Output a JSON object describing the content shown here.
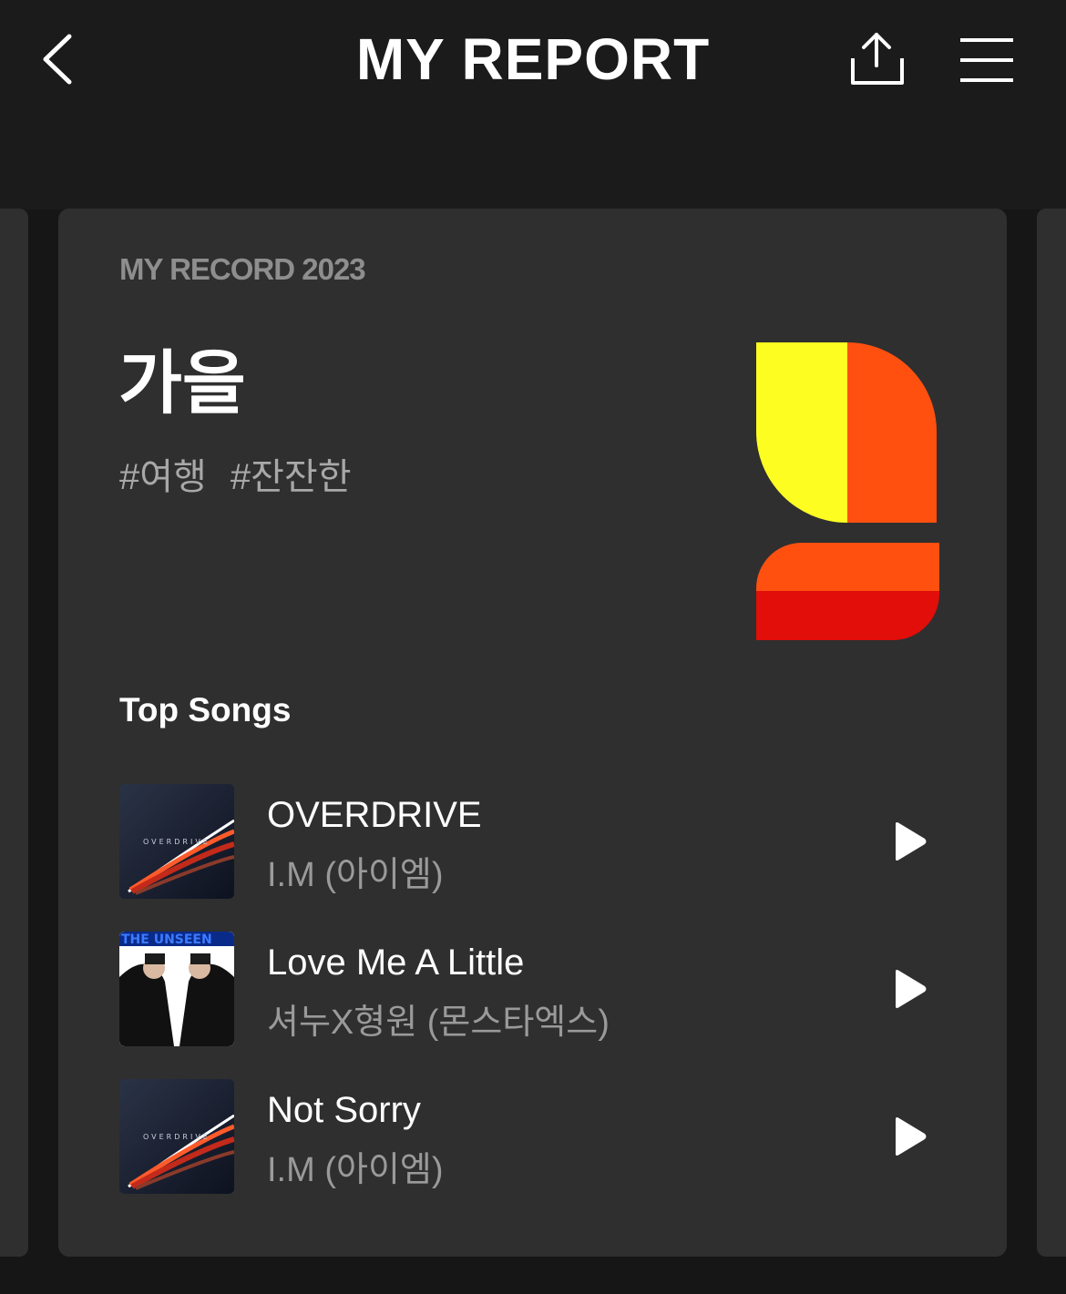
{
  "header": {
    "title": "MY REPORT",
    "back_icon": "chevron-left-icon",
    "share_icon": "share-icon",
    "menu_icon": "hamburger-menu-icon"
  },
  "report": {
    "record_label": "MY RECORD 2023",
    "season": "가을",
    "tags": [
      "#여행",
      "#잔잔한"
    ],
    "logo_colors": {
      "yellow": "#FDFD22",
      "orange": "#FF5010",
      "red": "#E10E0A"
    }
  },
  "top_songs": {
    "section_title": "Top Songs",
    "songs": [
      {
        "title": "OVERDRIVE",
        "artist": "I.M (아이엠)",
        "cover_text": "OVERDRIVE",
        "play_icon": "play-icon"
      },
      {
        "title": "Love Me A Little",
        "artist": "셔누X형원 (몬스타엑스)",
        "cover_text": "THE UNSEEN",
        "play_icon": "play-icon"
      },
      {
        "title": "Not Sorry",
        "artist": "I.M (아이엠)",
        "cover_text": "OVERDRIVE",
        "play_icon": "play-icon"
      }
    ]
  },
  "colors": {
    "background": "#161616",
    "card": "#2f2f2f",
    "text_primary": "#ffffff",
    "text_secondary": "#9a9a9a"
  }
}
